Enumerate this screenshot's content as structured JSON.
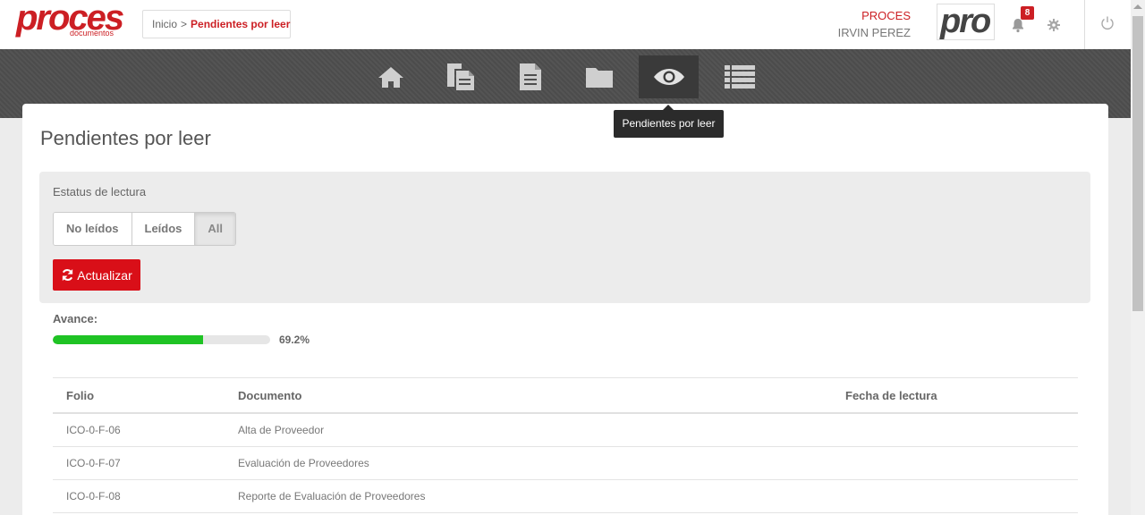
{
  "header": {
    "logo_text": "proces",
    "logo_subtext": "documentos",
    "breadcrumb": {
      "home": "Inicio",
      "separator": ">",
      "current": "Pendientes por leer"
    },
    "company": "PROCES",
    "user": "IRVIN PEREZ",
    "company_logo_text": "pro",
    "notifications_count": "8"
  },
  "nav": {
    "items": [
      {
        "icon": "home-icon"
      },
      {
        "icon": "copy-documents-icon"
      },
      {
        "icon": "document-icon"
      },
      {
        "icon": "folder-icon"
      },
      {
        "icon": "eye-icon",
        "active": true
      },
      {
        "icon": "list-icon"
      }
    ],
    "tooltip": "Pendientes por leer"
  },
  "page": {
    "title": "Pendientes por leer",
    "filter_label": "Estatus de lectura",
    "filters": [
      "No leídos",
      "Leídos",
      "All"
    ],
    "active_filter": "All",
    "refresh_label": "Actualizar",
    "progress_label": "Avance:",
    "progress_value": 69.2,
    "progress_text": "69.2%"
  },
  "table": {
    "headers": [
      "Folio",
      "Documento",
      "Fecha de lectura"
    ],
    "rows": [
      {
        "folio": "ICO-0-F-06",
        "documento": "Alta de Proveedor",
        "fecha": ""
      },
      {
        "folio": "ICO-0-F-07",
        "documento": "Evaluación de Proveedores",
        "fecha": ""
      },
      {
        "folio": "ICO-0-F-08",
        "documento": "Reporte de Evaluación de Proveedores",
        "fecha": ""
      }
    ]
  },
  "colors": {
    "brand": "#cc1f24",
    "progress": "#1fc324",
    "button": "#d90f18"
  }
}
